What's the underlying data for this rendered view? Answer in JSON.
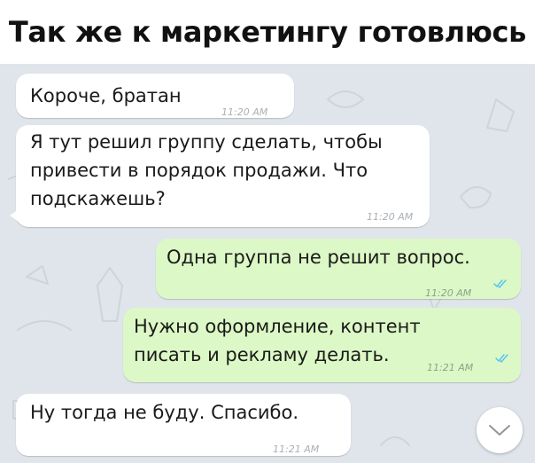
{
  "caption": "Так же к маркетингу готовлюсь",
  "colors": {
    "chat_background": "#dfe5ea",
    "incoming_bubble": "#ffffff",
    "outgoing_bubble": "#dcf8c6",
    "read_ticks": "#4fc3f7"
  },
  "messages": [
    {
      "direction": "incoming",
      "text": "Короче, братан",
      "time": "11:20 AM"
    },
    {
      "direction": "incoming",
      "line1": "Я тут решил группу сделать, чтобы",
      "line2": "привести в порядок продажи. Что",
      "line3": "подскажешь?",
      "time": "11:20 AM"
    },
    {
      "direction": "outgoing",
      "text": "Одна группа не решит вопрос.",
      "time": "11:20 AM",
      "status": "read"
    },
    {
      "direction": "outgoing",
      "line1": "Нужно оформление, контент",
      "line2": "писать и рекламу делать.",
      "time": "11:21 AM",
      "status": "read"
    },
    {
      "direction": "incoming",
      "text": "Ну тогда не буду. Спасибо.",
      "time": "11:21 AM"
    }
  ],
  "scroll_button": {
    "icon": "chevron-down-icon"
  }
}
